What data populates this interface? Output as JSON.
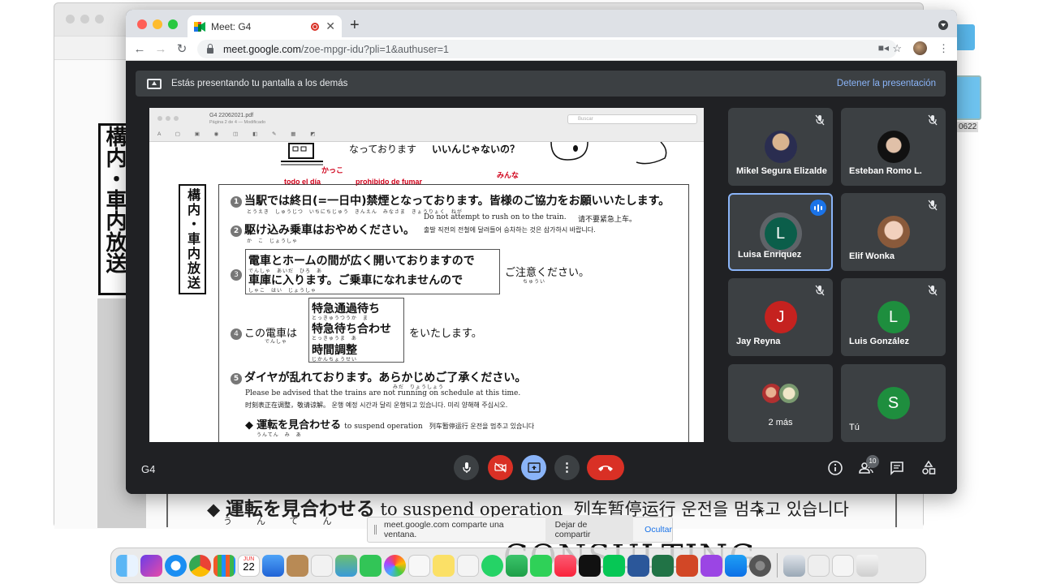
{
  "browser": {
    "tab_title": "Meet: G4",
    "url_host": "meet.google.com",
    "url_path": "/zoe-mpgr-idu?pli=1&authuser=1"
  },
  "meet": {
    "present_text": "Estás presentando tu pantalla a los demás",
    "stop_presenting": "Detener la presentación",
    "meeting_code": "G4",
    "people_count": "10"
  },
  "shared_doc": {
    "file_name": "G4 22062021.pdf",
    "file_sub": "Página 2 de 4 — Modificado",
    "search_placeholder": "Buscar",
    "top_line": "なっております",
    "top_line2": "いいんじゃないの？",
    "label_red1": "かっこ",
    "label_red2": "todo el día",
    "label_red3": "prohibido de fumar",
    "label_red4": "みんな",
    "side_title": "構内・車内放送",
    "l1": "当駅では終日(=一日中)禁煙となっております。皆様のご協力をお願いいたします。",
    "l1_ruby": "とうえき　しゅうじつ　いちにちじゅう　きんえん　みなさま　きょうりょく　ねが",
    "l1_en": "Do not attempt to rush on to the train.",
    "l1_cn": "请不要紧急上车。",
    "l2": "駆け込み乗車はおやめください。",
    "l2_ruby": "か　こ　じょうしゃ",
    "l2_kr": "출발 직전의 전철에 달려들어 승차하는 것은 삼가하시 바랍니다.",
    "l3a": "電車とホームの間が広く開いておりますので",
    "l3a_ruby": "でんしゃ　あいだ　ひろ　あ",
    "l3b": "車庫に入ります。ご乗車になれませんので",
    "l3b_ruby": "しゃこ　はい　じょうしゃ",
    "l3_tail": "ご注意ください。",
    "l3_tail_ruby": "ちゅうい",
    "l4_head": "この電車は",
    "l4_head_ruby": "でんしゃ",
    "l4_opt1": "特急通過待ち",
    "l4_opt1_ruby": "とっきゅうつうか　ま",
    "l4_opt2": "特急待ち合わせ",
    "l4_opt2_ruby": "とっきゅうま　あ",
    "l4_opt3": "時間調整",
    "l4_opt3_ruby": "じかんちょうせい",
    "l4_tail": "をいたします。",
    "l5": "ダイヤが乱れております。あらかじめご了承ください。",
    "l5_ruby": "みだ　りょうしょう",
    "l5_en": "Please be advised that the trains are not running on schedule at this time.",
    "l5_cn": "时刻表正在调整，敬请谅解。 운행 예정 시간과 달리 운행되고 있습니다. 미리 양해해 주십시오.",
    "l6": "運転を見合わせる",
    "l6_ruby": "うんてん　み　あ",
    "l6_en": "to suspend operation",
    "l6_cn": "列车暂停运行 운전을 멈추고 있습니다",
    "circled": [
      "1",
      "2",
      "3",
      "4",
      "5"
    ]
  },
  "participants": [
    {
      "name": "Mikel Segura Elizalde",
      "initial": "",
      "muted": true,
      "color": "#3c4043"
    },
    {
      "name": "Esteban Romo L.",
      "initial": "",
      "muted": true,
      "color": "#3c4043"
    },
    {
      "name": "Luisa Enriquez",
      "initial": "L",
      "muted": false,
      "color": "#0b5e4a",
      "speaking": true
    },
    {
      "name": "Elif Wonka",
      "initial": "",
      "muted": true,
      "color": "#3c4043"
    },
    {
      "name": "Jay Reyna",
      "initial": "J",
      "muted": true,
      "color": "#c5221f"
    },
    {
      "name": "Luis González",
      "initial": "L",
      "muted": true,
      "color": "#1e8e3e"
    },
    {
      "name": "2 más",
      "initial": "",
      "muted": false
    },
    {
      "name": "Tú",
      "initial": "S",
      "muted": false,
      "color": "#1e8e3e"
    }
  ],
  "background": {
    "side_kanji": "構内・車内放送",
    "bottom_big": "運転を見合わせる",
    "bottom_ruby": "うんてん　み　あ",
    "bottom_en": "to suspend operation",
    "bottom_cn": "列车暂停运行 운전을 멈추고 있습니다",
    "consulting": "CONSULTING",
    "folder_label": "0622"
  },
  "notification": {
    "message": "meet.google.com comparte una ventana.",
    "stop_button": "Dejar de compartir",
    "hide_button": "Ocultar"
  },
  "dock": {
    "calendar_month": "JUN",
    "calendar_day": "22"
  },
  "colors": {
    "meet_bg": "#202124",
    "tile_bg": "#3c4043",
    "accent_blue": "#8ab4f8",
    "end_call_red": "#d93025"
  }
}
